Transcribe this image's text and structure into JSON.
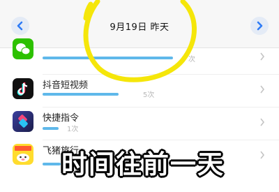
{
  "header": {
    "date_label": "9月19日 昨天",
    "prev_icon": "chevron-left-icon",
    "next_icon": "chevron-right-icon",
    "accent_color": "#2f7cf6"
  },
  "apps": [
    {
      "name": "",
      "usage_count": "次",
      "icon": "wechat-icon",
      "bar_fraction": 0.72
    },
    {
      "name": "抖音短视频",
      "usage_count": "5次",
      "icon": "tiktok-icon",
      "bar_fraction": 0.42
    },
    {
      "name": "快捷指令",
      "usage_count": "1次",
      "icon": "shortcuts-icon",
      "bar_fraction": 0.09
    },
    {
      "name": "飞猪旅行",
      "usage_count": "",
      "icon": "fliggy-icon",
      "bar_fraction": 0.1
    }
  ],
  "overlay_caption": "时间往前一天",
  "annotation_color": "#f5e60a",
  "bar_color": "#5fb8ea"
}
